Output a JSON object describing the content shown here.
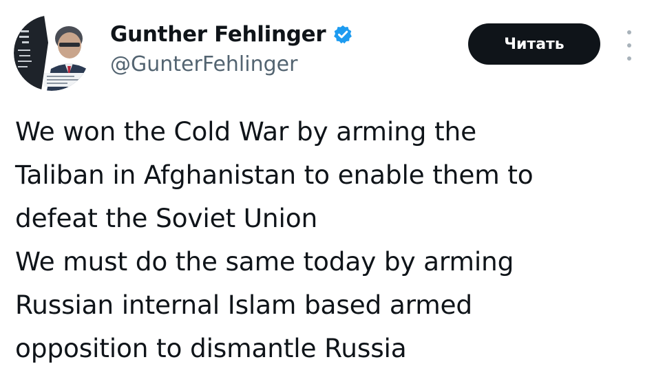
{
  "author": {
    "display_name": "Gunther Fehlinger",
    "handle": "@GunterFehlinger",
    "verified_icon": "verified-badge-icon",
    "verified_color": "#1d9bf0"
  },
  "actions": {
    "follow_label": "Читать",
    "more_icon": "more-vertical-icon"
  },
  "tweet": {
    "lines": [
      "We won the Cold War by arming the",
      "Taliban in Afghanistan to enable them to",
      "defeat the Soviet Union",
      "We must do the same today by arming",
      "Russian internal Islam based armed",
      "opposition to dismantle Russia"
    ]
  },
  "colors": {
    "text": "#0f1419",
    "secondary": "#536471",
    "button_bg": "#0f1419",
    "button_text": "#ffffff"
  }
}
